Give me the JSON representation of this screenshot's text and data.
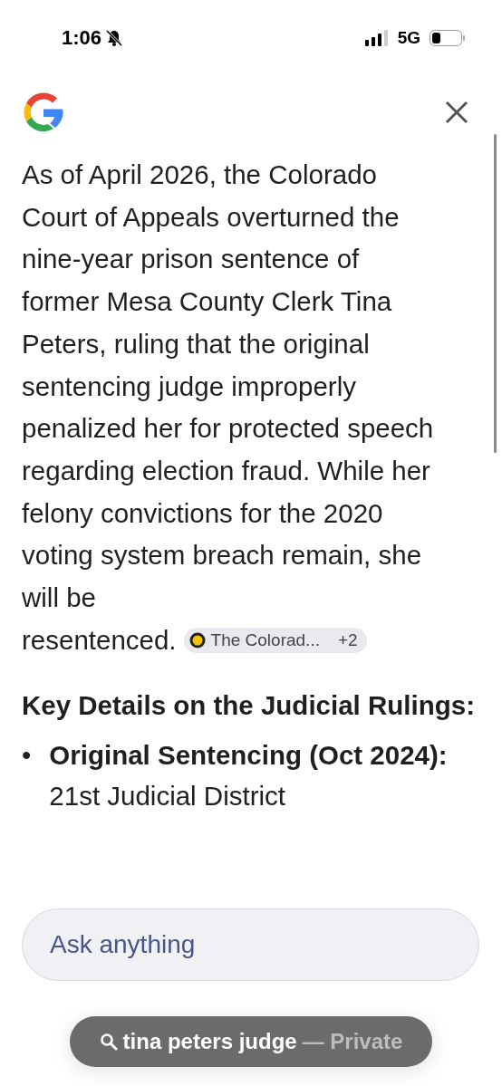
{
  "status_bar": {
    "time": "1:06",
    "network": "5G"
  },
  "answer": {
    "lines": [
      "As of April 2026, the Colorado",
      "Court of Appeals overturned the",
      "nine-year prison sentence of",
      "former Mesa County Clerk Tina",
      "Peters, ruling that the original",
      "sentencing judge improperly",
      "penalized her for protected speech",
      "regarding election fraud. While her",
      "felony convictions for the 2020",
      "voting system breach remain, she",
      "will be",
      "resentenced."
    ],
    "source_chip": {
      "label": "The Colorad...",
      "count": "+2"
    }
  },
  "heading": "Key Details on the Judicial Rulings:",
  "bullets": [
    {
      "marker": "•",
      "text": "**Original Sentencing (Oct 2024):** 21st Judicial District"
    }
  ],
  "ask_field": {
    "placeholder": "Ask anything"
  },
  "search_pill": {
    "query": "tina peters judge",
    "suffix": "— Private"
  }
}
